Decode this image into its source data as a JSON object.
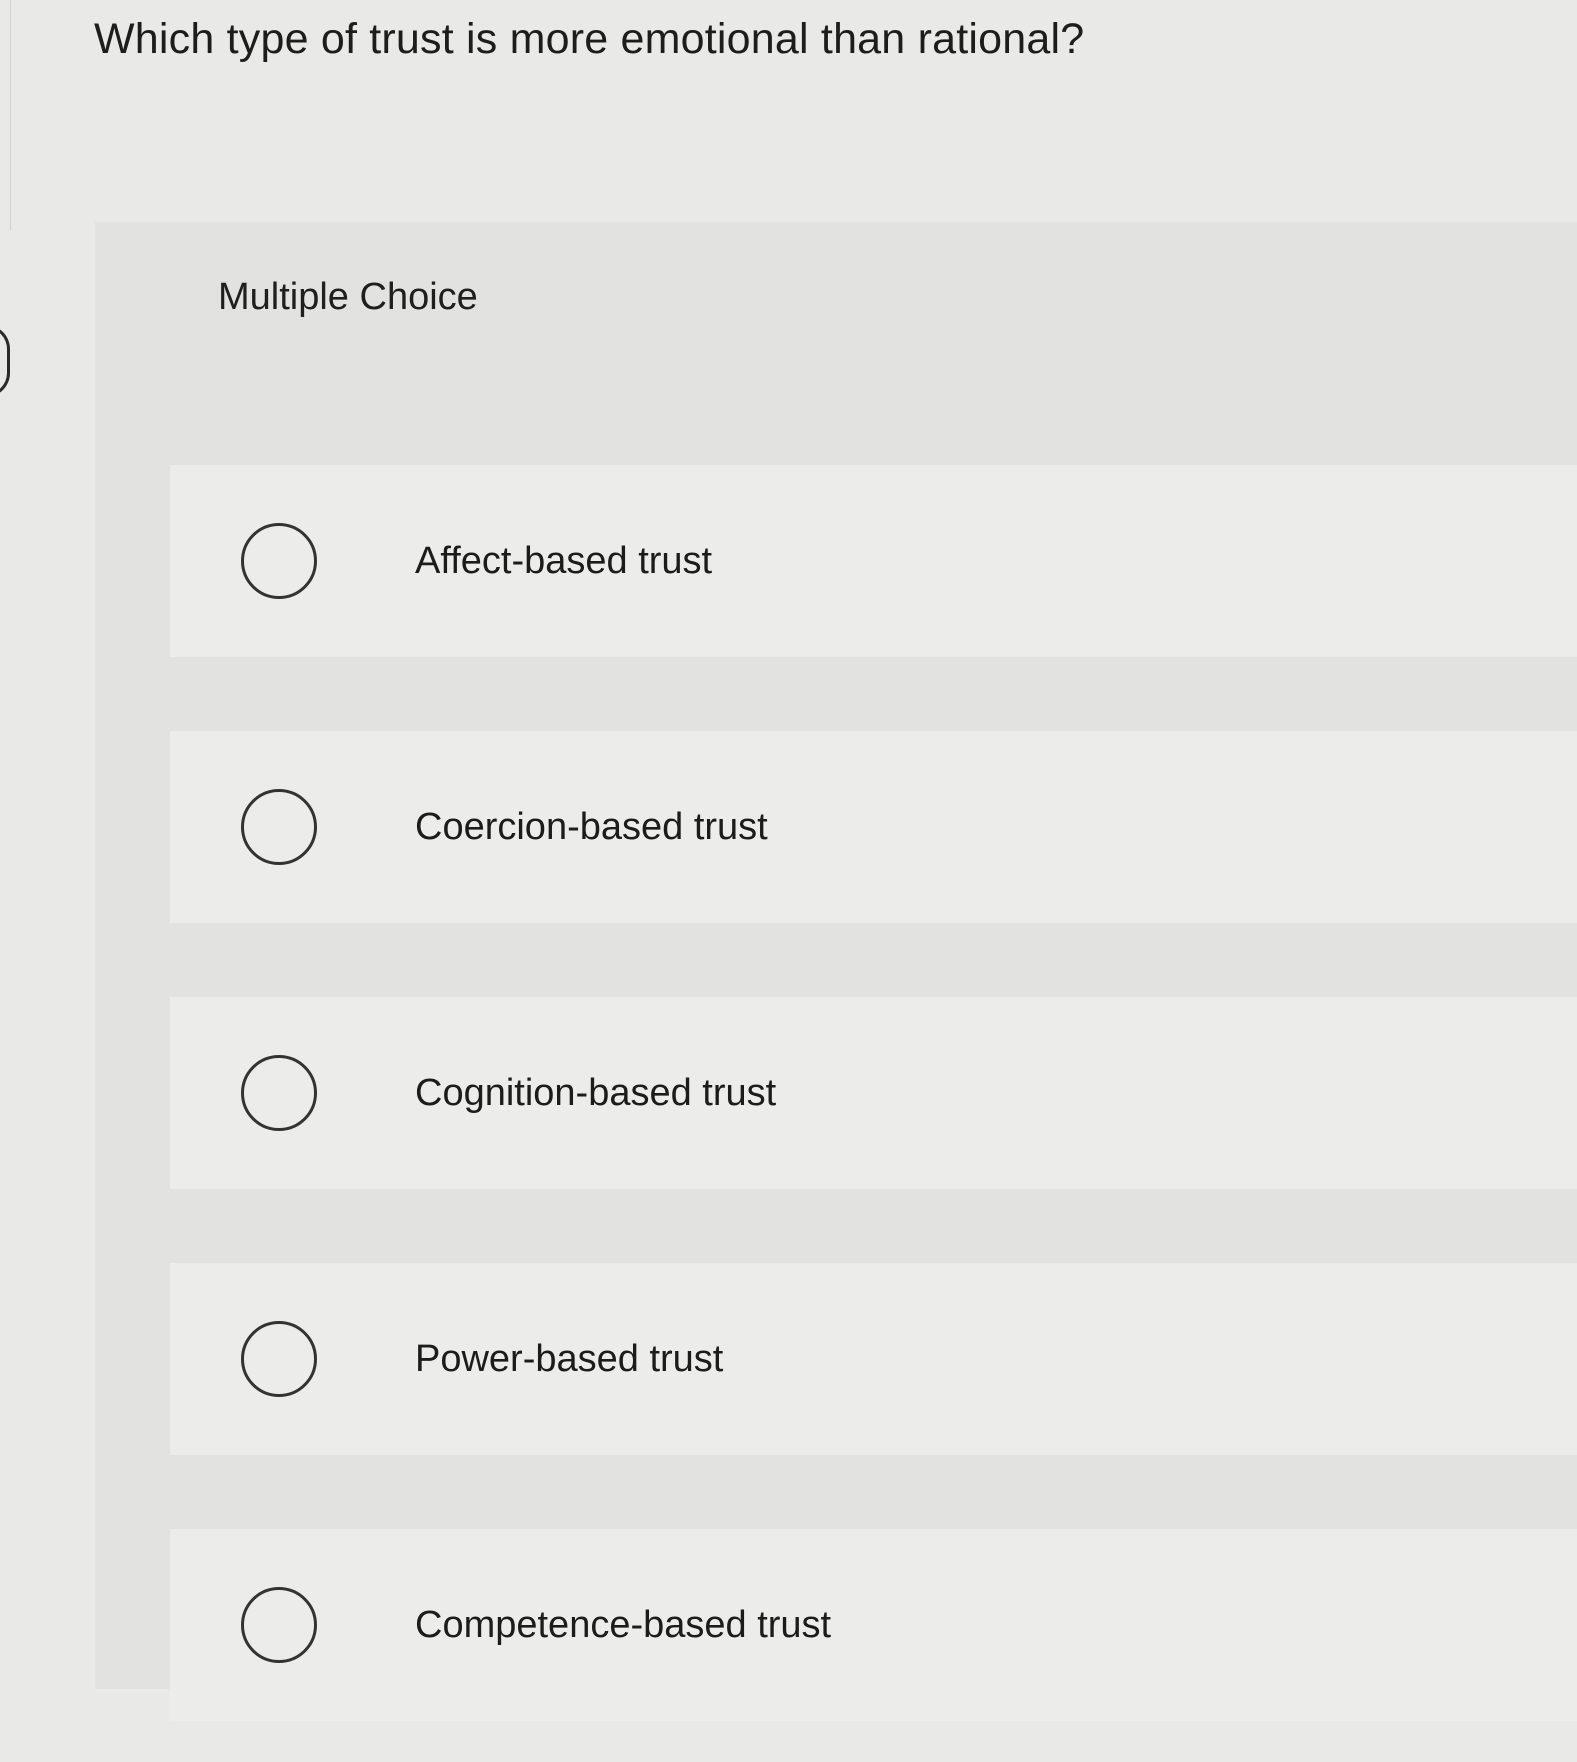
{
  "question": {
    "text": "Which type of trust is more emotional than rational?"
  },
  "section_label": "Multiple Choice",
  "options": [
    {
      "label": "Affect-based trust",
      "selected": false
    },
    {
      "label": "Coercion-based trust",
      "selected": false
    },
    {
      "label": "Cognition-based trust",
      "selected": false
    },
    {
      "label": "Power-based trust",
      "selected": false
    },
    {
      "label": "Competence-based trust",
      "selected": false
    }
  ]
}
